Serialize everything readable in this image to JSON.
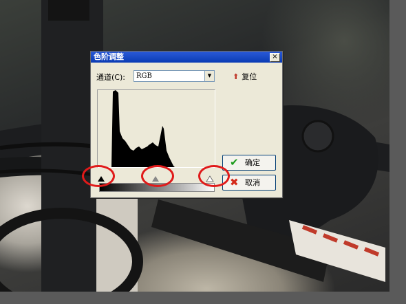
{
  "dialog": {
    "title": "色阶调整",
    "close_label": "×",
    "channel_label": "通道(C):",
    "channel_value": "RGB",
    "reset_label": "复位",
    "ok_label": "确定",
    "cancel_label": "取消"
  },
  "sliders": {
    "black_input": 0.0,
    "gamma_input": 0.5,
    "white_input": 1.0
  },
  "colors": {
    "titlebar": "#0a3bb4",
    "annotation": "#e01a1a",
    "ok_check": "#1a9a1a",
    "cancel_x": "#d42a1a"
  }
}
